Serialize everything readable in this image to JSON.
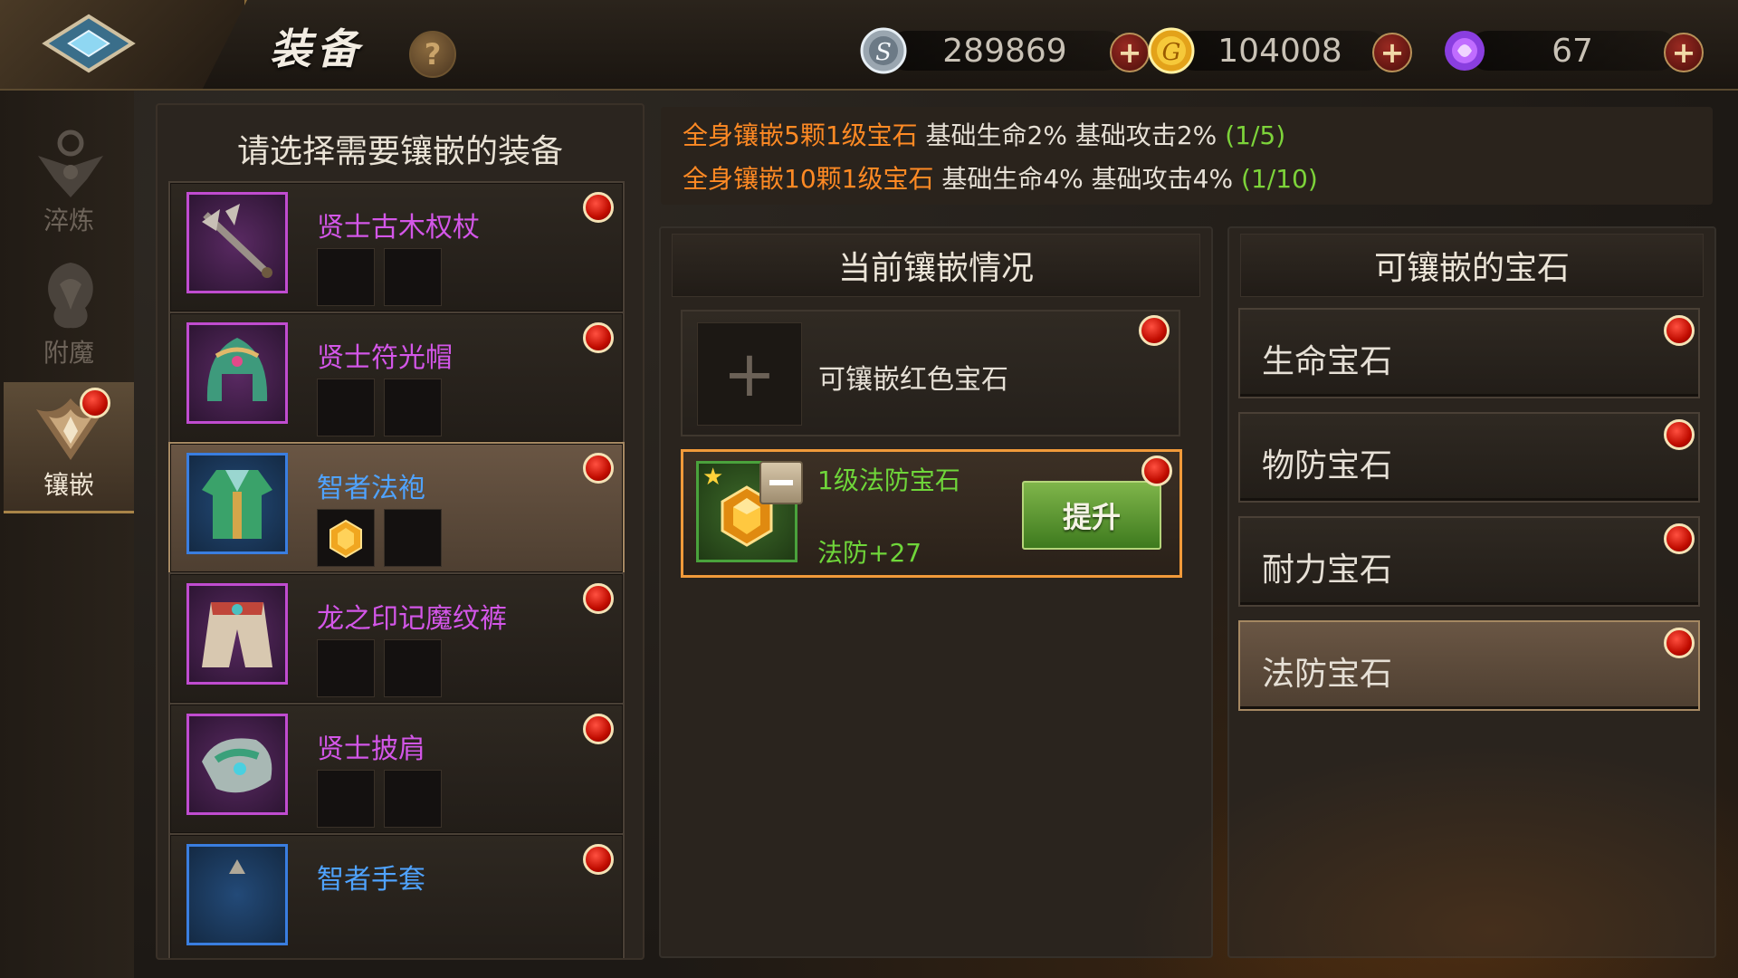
{
  "header": {
    "title": "装备",
    "help_label": "?",
    "currencies": [
      {
        "name": "silver",
        "icon": "silver-coin-icon",
        "value": "289869",
        "add_label": "+"
      },
      {
        "name": "gold",
        "icon": "gold-coin-icon",
        "value": "104008",
        "add_label": "+"
      },
      {
        "name": "crystal",
        "icon": "purple-crystal-icon",
        "value": "67",
        "add_label": "+"
      }
    ]
  },
  "sidebar": {
    "items": [
      {
        "label": "淬炼",
        "icon": "refine-emblem-icon",
        "active": false
      },
      {
        "label": "附魔",
        "icon": "enchant-dragon-icon",
        "active": false
      },
      {
        "label": "镶嵌",
        "icon": "inlay-wings-icon",
        "active": true
      }
    ]
  },
  "equipment_list": {
    "title": "请选择需要镶嵌的装备",
    "items": [
      {
        "name": "贤士古木权杖",
        "icon": "staff-icon",
        "quality": "purple",
        "selected": false
      },
      {
        "name": "贤士符光帽",
        "icon": "helmet-icon",
        "quality": "purple",
        "selected": false
      },
      {
        "name": "智者法袍",
        "icon": "robe-icon",
        "quality": "blue",
        "selected": true
      },
      {
        "name": "龙之印记魔纹裤",
        "icon": "pants-icon",
        "quality": "purple",
        "selected": false
      },
      {
        "name": "贤士披肩",
        "icon": "shoulder-icon",
        "quality": "purple",
        "selected": false
      },
      {
        "name": "智者手套",
        "icon": "gloves-icon",
        "quality": "blue",
        "selected": false
      }
    ]
  },
  "bonus": {
    "lines": [
      {
        "req": "全身镶嵌5颗1级宝石",
        "effect": "基础生命2% 基础攻击2%",
        "progress": "(1/5)"
      },
      {
        "req": "全身镶嵌10颗1级宝石",
        "effect": "基础生命4% 基础攻击4%",
        "progress": "(1/10)"
      }
    ]
  },
  "current_inlay": {
    "title": "当前镶嵌情况",
    "empty_slot_label": "可镶嵌红色宝石",
    "add_symbol": "+",
    "gem": {
      "name": "1级法防宝石",
      "stat": "法防+27",
      "upgrade_label": "提升"
    }
  },
  "available_gems": {
    "title": "可镶嵌的宝石",
    "items": [
      {
        "label": "生命宝石",
        "selected": false
      },
      {
        "label": "物防宝石",
        "selected": false
      },
      {
        "label": "耐力宝石",
        "selected": false
      },
      {
        "label": "法防宝石",
        "selected": true
      }
    ]
  },
  "colors": {
    "accent_orange": "#f19a3a",
    "purple_quality": "#d356e8",
    "blue_quality": "#4fa3ff",
    "green_text": "#6fd63a",
    "notice_red": "#e01a10"
  }
}
